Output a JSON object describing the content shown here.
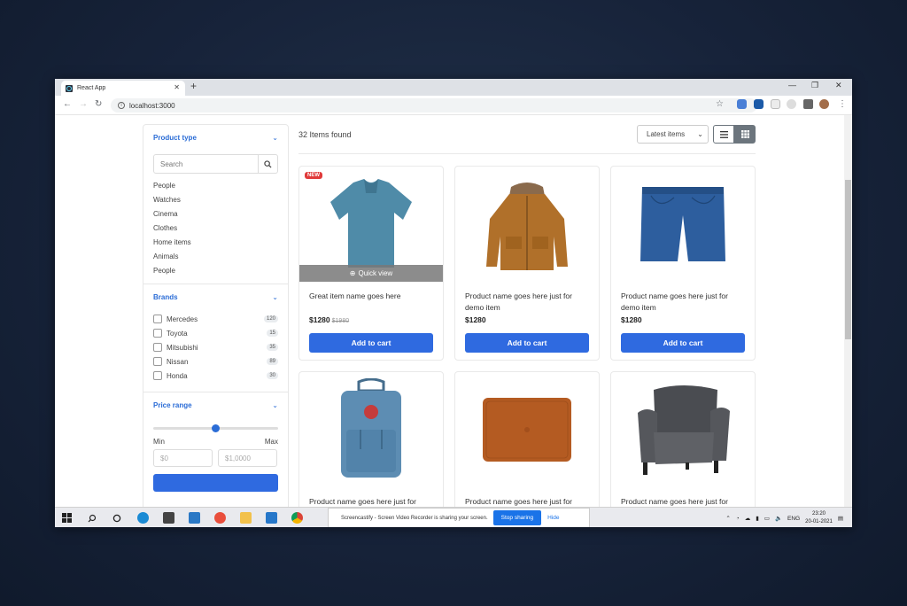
{
  "browser": {
    "tab_title": "React App",
    "new_tab": "+",
    "url": "localhost:3000",
    "win_min": "—",
    "win_max": "❐",
    "win_close": "✕",
    "tab_close": "✕"
  },
  "sidebar": {
    "product_type": {
      "title": "Product type",
      "search_placeholder": "Search",
      "categories": [
        "People",
        "Watches",
        "Cinema",
        "Clothes",
        "Home items",
        "Animals",
        "People"
      ]
    },
    "brands": {
      "title": "Brands",
      "items": [
        {
          "name": "Mercedes",
          "count": "120"
        },
        {
          "name": "Toyota",
          "count": "15"
        },
        {
          "name": "Mitsubishi",
          "count": "35"
        },
        {
          "name": "Nissan",
          "count": "89"
        },
        {
          "name": "Honda",
          "count": "30"
        }
      ]
    },
    "price_range": {
      "title": "Price range",
      "slider_value": 0.5,
      "min_label": "Min",
      "max_label": "Max",
      "min_placeholder": "$0",
      "max_placeholder": "$1,0000"
    }
  },
  "main": {
    "items_found": "32 Items found",
    "sort_value": "Latest items",
    "products": [
      {
        "title": "Great item name goes here",
        "price": "$1280",
        "old_price": "$1980",
        "badge": "NEW",
        "quick_view": "Quick view",
        "button": "Add to cart",
        "image": "polo-shirt"
      },
      {
        "title": "Product name goes here just for demo item",
        "price": "$1280",
        "button": "Add to cart",
        "image": "jacket"
      },
      {
        "title": "Product name goes here just for demo item",
        "price": "$1280",
        "button": "Add to cart",
        "image": "jeans-shorts"
      },
      {
        "title": "Product name goes here just for",
        "image": "backpack"
      },
      {
        "title": "Product name goes here just for",
        "image": "laptop-sleeve"
      },
      {
        "title": "Product name goes here just for",
        "image": "armchair"
      }
    ]
  },
  "taskbar": {
    "share_message": "Screencastify - Screen Video Recorder is sharing your screen.",
    "stop_label": "Stop sharing",
    "hide_label": "Hide",
    "lang": "ENG",
    "time": "23:20",
    "date": "20-01-2021"
  },
  "colors": {
    "accent": "#2f6ae0",
    "link": "#2a6cd6",
    "badge": "#e03b3b"
  }
}
